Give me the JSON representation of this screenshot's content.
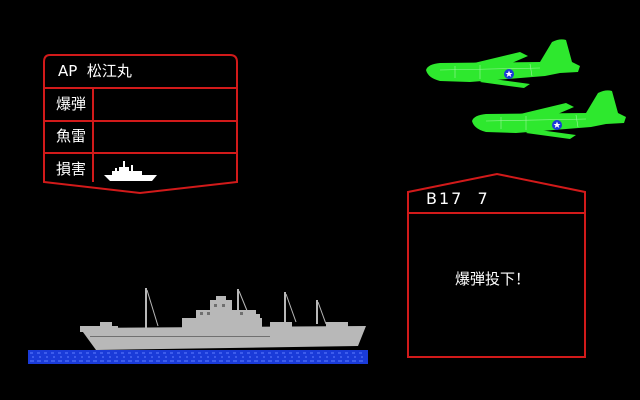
{
  "ship_panel": {
    "title": "AP  松江丸",
    "rows": [
      {
        "label": "爆弾",
        "value": ""
      },
      {
        "label": "魚雷",
        "value": ""
      },
      {
        "label": "損害",
        "value": "",
        "status_icon": "warship-silhouette-icon"
      }
    ]
  },
  "attack_panel": {
    "title": "B17  7",
    "message": "爆弾投下！"
  },
  "colors": {
    "frame": "#d21a1a",
    "plane": "#2ee82e",
    "ship": "#b8b8b8",
    "sea": "#1a3bd8",
    "background": "#000000"
  },
  "planes": [
    {
      "type": "B-17",
      "icon": "b17-bomber-icon"
    },
    {
      "type": "B-17",
      "icon": "b17-bomber-icon"
    }
  ],
  "ship": {
    "icon": "transport-ship-icon"
  }
}
